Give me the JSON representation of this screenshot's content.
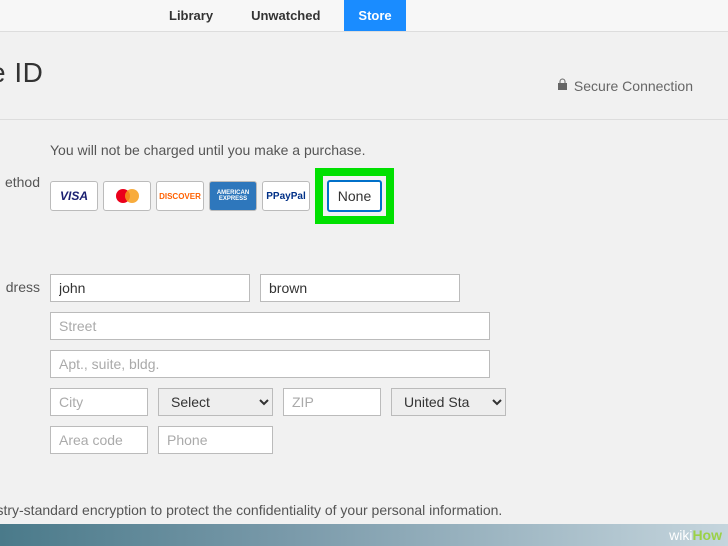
{
  "tabs": {
    "library": "Library",
    "unwatched": "Unwatched",
    "store": "Store"
  },
  "title": "e ID",
  "secure_label": "Secure Connection",
  "notice": "You will not be charged until you make a purchase.",
  "method_label": "ethod",
  "payment_methods": {
    "visa": "VISA",
    "mastercard": "",
    "discover": "DISCOVER",
    "amex": "AMERICAN EXPRESS",
    "paypal": "PayPal",
    "none": "None"
  },
  "address_label": "dress",
  "address": {
    "first_name": "john",
    "last_name": "brown",
    "street_ph": "Street",
    "apt_ph": "Apt., suite, bldg.",
    "city_ph": "City",
    "state_select": "Select",
    "zip_ph": "ZIP",
    "country_select": "United Sta",
    "area_ph": "Area code",
    "phone_ph": "Phone"
  },
  "footer": "industry-standard encryption to protect the confidentiality of your personal information.",
  "watermark": {
    "wiki": "wiki",
    "how": "How"
  }
}
